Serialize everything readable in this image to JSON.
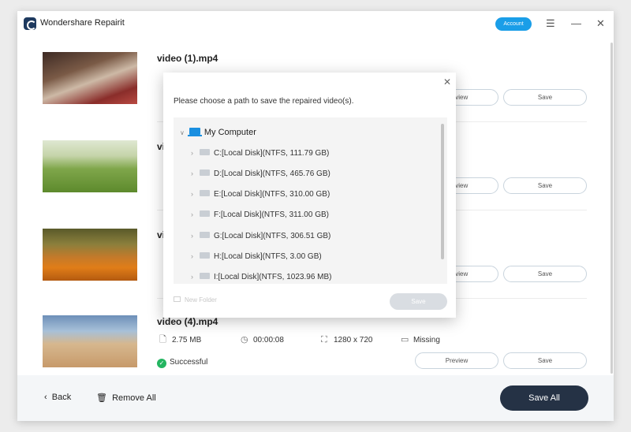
{
  "app": {
    "title": "Wondershare Repairit",
    "account_label": "Account",
    "menu_icon": "hamburger-icon",
    "minimize_icon": "minimize-icon",
    "close_icon": "close-icon"
  },
  "videos": [
    {
      "name": "video (1).mp4",
      "size": "",
      "duration": "",
      "resolution": "",
      "audio": "",
      "status": "",
      "preview_label": "Preview",
      "save_label": "Save"
    },
    {
      "name": "vi",
      "size": "",
      "duration": "",
      "resolution": "",
      "audio": "",
      "status": "",
      "preview_label": "Preview",
      "save_label": "Save"
    },
    {
      "name": "vi",
      "size": "",
      "duration": "",
      "resolution": "",
      "audio": "",
      "status": "",
      "preview_label": "Preview",
      "save_label": "Save"
    },
    {
      "name": "video (4).mp4",
      "size": "2.75  MB",
      "duration": "00:00:08",
      "resolution": "1280 x 720",
      "audio": "Missing",
      "status": "Successful",
      "preview_label": "Preview",
      "save_label": "Save"
    }
  ],
  "footer": {
    "back_label": "Back",
    "remove_all_label": "Remove All",
    "save_all_label": "Save All"
  },
  "dialog": {
    "message": "Please choose a path to save the repaired video(s).",
    "root_label": "My Computer",
    "drives": [
      "C:[Local Disk](NTFS, 111.79  GB)",
      "D:[Local Disk](NTFS, 465.76  GB)",
      "E:[Local Disk](NTFS, 310.00  GB)",
      "F:[Local Disk](NTFS, 311.00  GB)",
      "G:[Local Disk](NTFS, 306.51  GB)",
      "H:[Local Disk](NTFS, 3.00  GB)",
      "I:[Local Disk](NTFS, 1023.96  MB)"
    ],
    "new_folder_label": "New Folder",
    "save_label": "Save"
  }
}
